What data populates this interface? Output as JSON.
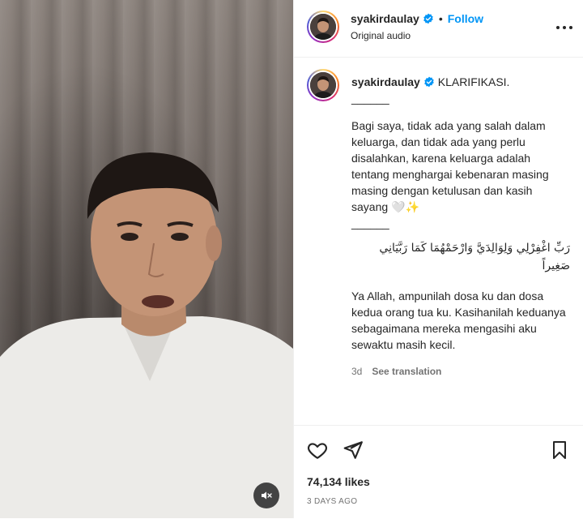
{
  "header": {
    "username": "syakirdaulay",
    "dot": "•",
    "follow_label": "Follow",
    "audio_label": "Original audio"
  },
  "caption": {
    "username": "syakirdaulay",
    "title": "KLARIFIKASI.",
    "divider1": "______",
    "paragraph1": "Bagi saya, tidak ada yang salah dalam keluarga, dan tidak ada yang perlu disalahkan, karena keluarga adalah tentang menghargai kebenaran masing masing dengan ketulusan dan kasih sayang",
    "emoji": "🤍✨",
    "divider2": "______",
    "arabic": "رَبِّ اغْفِرْلِي وَلِوَالِدَيَّ وَارْحَمْهُمَا كَمَا رَبَّيَانِي صَغِيراً",
    "paragraph2": "Ya Allah, ampunilah dosa ku dan dosa kedua orang tua ku. Kasihanilah keduanya sebagaimana mereka mengasihi aku sewaktu masih kecil.",
    "age": "3d",
    "see_translation": "See translation"
  },
  "footer": {
    "likes": "74,134 likes",
    "date": "3 DAYS AGO"
  },
  "icons": {
    "verified": "verified-badge-icon",
    "more": "more-options-icon",
    "like": "heart-icon",
    "share": "send-icon",
    "save": "bookmark-icon",
    "mute": "muted-speaker-icon"
  },
  "colors": {
    "accent": "#0095f6",
    "verified": "#0095f6",
    "text": "#262626",
    "muted": "#737373"
  }
}
